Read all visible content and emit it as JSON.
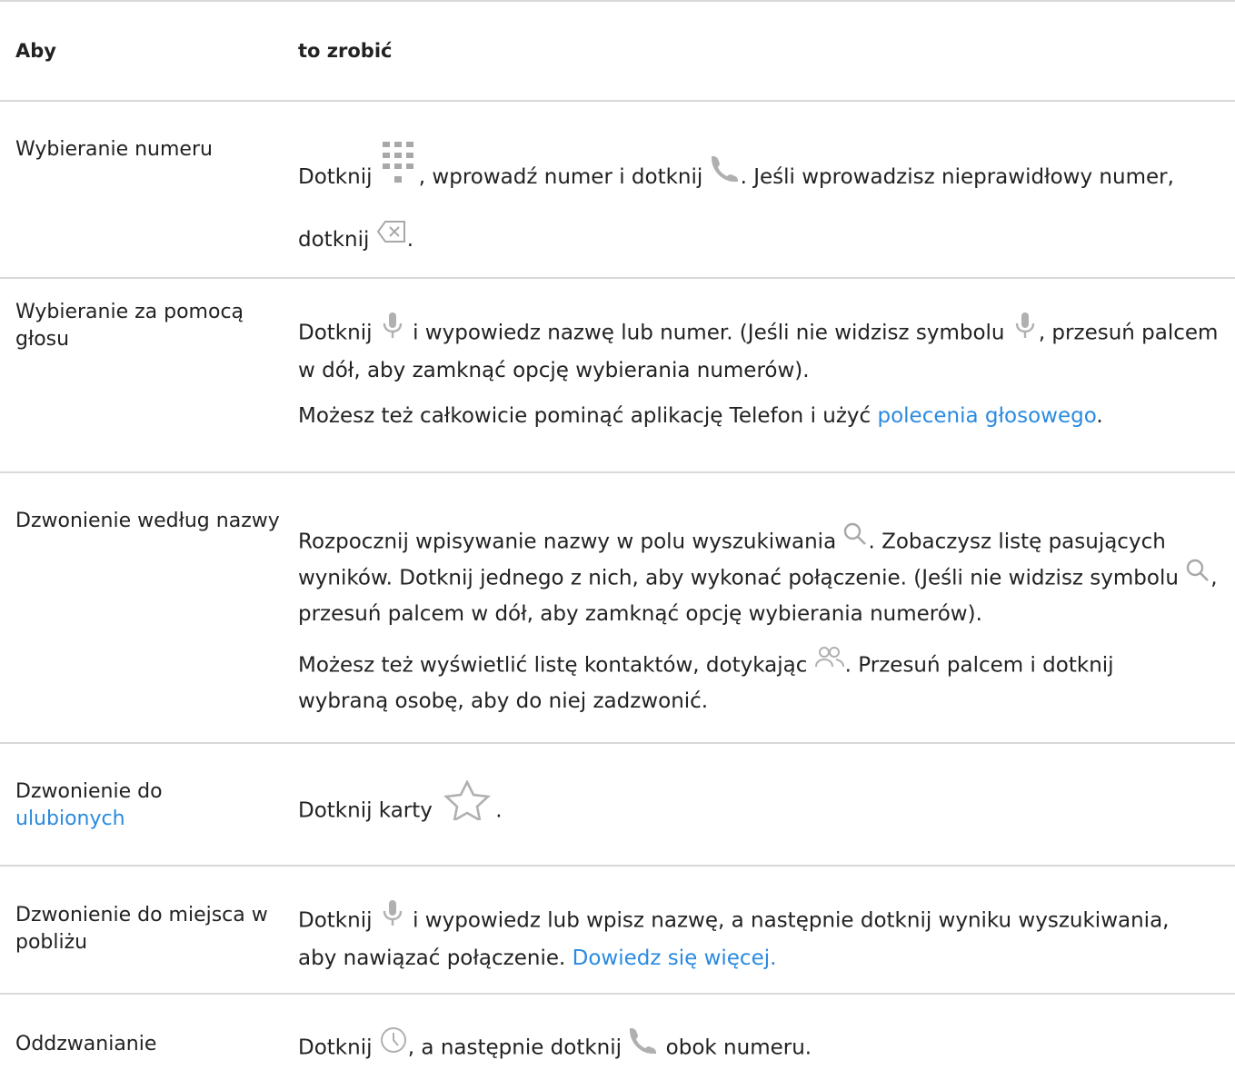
{
  "headers": {
    "col1": "Aby",
    "col2": "to zrobić"
  },
  "rows": [
    {
      "name": "Wybieranie numeru",
      "p1": {
        "a": "Dotknij",
        "b": ", wprowadź numer i dotknij",
        "c": ". Jeśli wprowadzisz nieprawidłowy numer, dotknij",
        "d": "."
      }
    },
    {
      "name": "Wybieranie za pomocą głosu",
      "p1": {
        "a": "Dotknij",
        "b": "i wypowiedz nazwę lub numer. (Jeśli nie widzisz symbolu",
        "c": ", przesuń palcem w dół, aby zamknąć opcję wybierania numerów)."
      },
      "p2": {
        "a": "Możesz też całkowicie pominąć aplikację Telefon i użyć",
        "link": "polecenia głosowego",
        "b": "."
      }
    },
    {
      "name": "Dzwonienie według nazwy",
      "p1": {
        "a": "Rozpocznij wpisywanie nazwy w polu wyszukiwania",
        "b": ". Zobaczysz listę pasujących wyników. Dotknij jednego z nich, aby wykonać połączenie. (Jeśli nie widzisz symbolu",
        "c": ", przesuń palcem w dół, aby zamknąć opcję wybierania numerów)."
      },
      "p2": {
        "a": "Możesz też wyświetlić listę kontaktów, dotykając",
        "b": ". Przesuń palcem i dotknij wybraną osobę, aby do niej zadzwonić."
      }
    },
    {
      "name_a": "Dzwonienie do",
      "name_link": "ulubionych",
      "p1": {
        "a": "Dotknij karty",
        "b": "."
      }
    },
    {
      "name": "Dzwonienie do miejsca w pobliżu",
      "p1": {
        "a": "Dotknij",
        "b": "i wypowiedz lub wpisz nazwę, a następnie dotknij wyniku wyszukiwania, aby nawiązać połączenie.",
        "link": "Dowiedz się więcej."
      }
    },
    {
      "name": "Oddzwanianie",
      "p1": {
        "a": "Dotknij",
        "b": ", a następnie dotknij",
        "c": "obok numeru."
      }
    }
  ],
  "icons": [
    "dialpad-icon",
    "phone-icon",
    "backspace-icon",
    "mic-icon",
    "search-icon",
    "contacts-icon",
    "star-icon",
    "clock-icon"
  ],
  "colors": {
    "link": "#2a8ae0",
    "icon": "#9e9e9e",
    "divider": "#d9d9d9"
  }
}
